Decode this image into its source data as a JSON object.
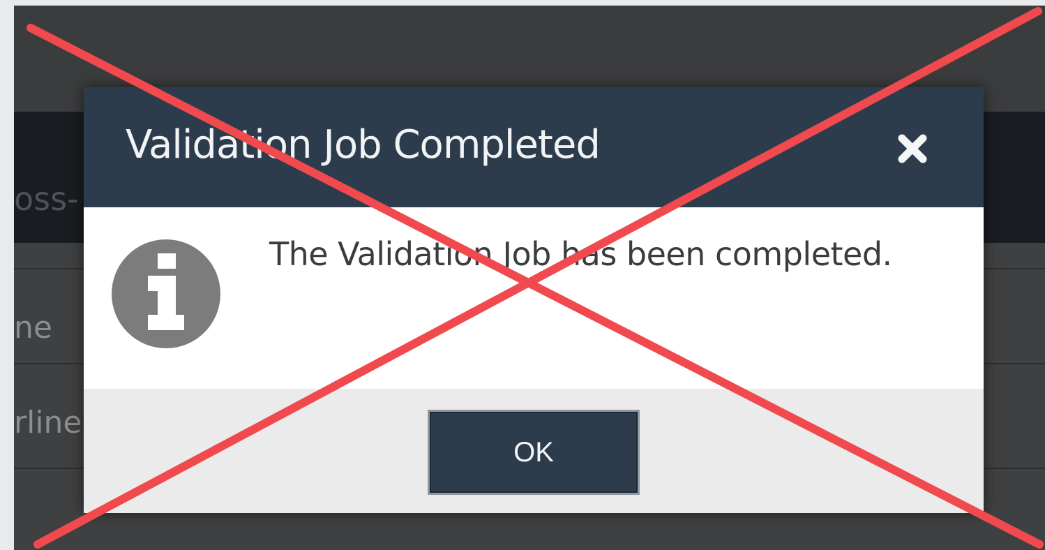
{
  "background": {
    "header_fragment": "oss-",
    "row1_fragment": "ne",
    "row2_fragment": "rline"
  },
  "dialog": {
    "title": "Validation Job Completed",
    "close_icon": "close-icon",
    "info_icon": "info-icon",
    "message": "The Validation Job has been completed.",
    "ok_label": "OK"
  },
  "overlay": {
    "mark": "red-x-cross",
    "color": "#f04a4e"
  }
}
